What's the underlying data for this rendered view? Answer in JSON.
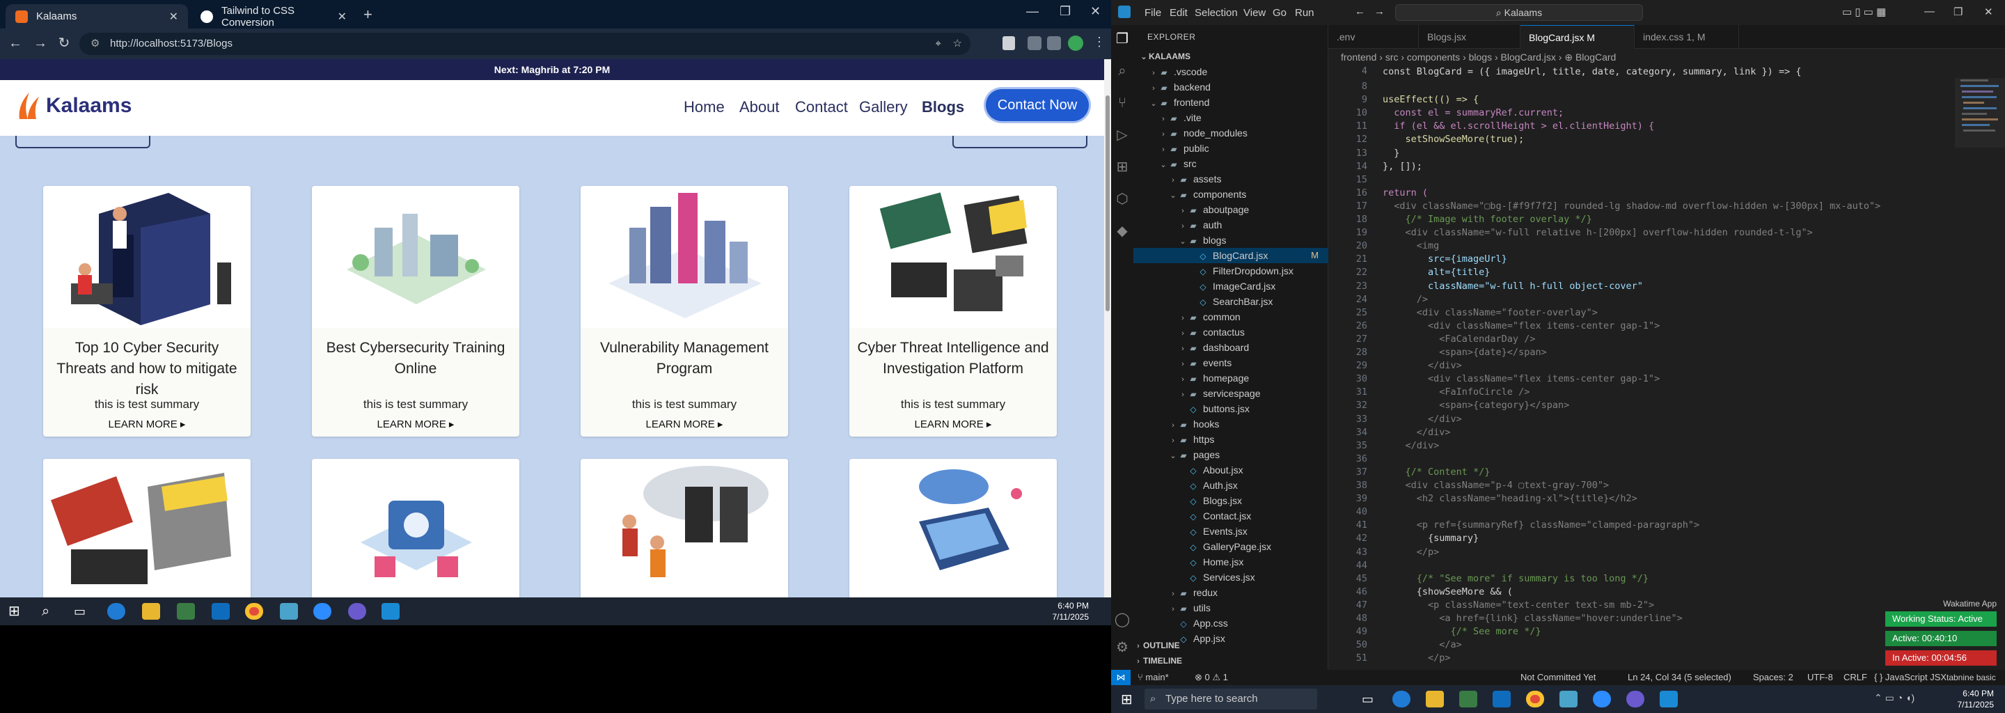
{
  "browser": {
    "tabs": [
      {
        "title": "Kalaams",
        "active": true
      },
      {
        "title": "Tailwind to CSS Conversion",
        "active": false
      }
    ],
    "new_tab": "+",
    "url": "http://localhost:5173/Blogs"
  },
  "site": {
    "prayer_bar": "Next: Maghrib at 7:20 PM",
    "logo_text": "Kalaams",
    "nav": [
      "Home",
      "About",
      "Contact",
      "Gallery",
      "Blogs"
    ],
    "contact_button": "Contact Now",
    "cards": [
      {
        "title": "Top 10 Cyber Security Threats and how to mitigate risk",
        "summary": "this is test summary",
        "learn": "LEARN MORE ▸"
      },
      {
        "title": "Best Cybersecurity Training Online",
        "summary": "this is test summary",
        "learn": "LEARN MORE ▸"
      },
      {
        "title": "Vulnerability Management Program",
        "summary": "this is test summary",
        "learn": "LEARN MORE ▸"
      },
      {
        "title": "Cyber Threat Intelligence and Investigation Platform",
        "summary": "this is test summary",
        "learn": "LEARN MORE ▸"
      },
      {
        "title": "",
        "summary": "",
        "learn": ""
      },
      {
        "title": "",
        "summary": "",
        "learn": ""
      },
      {
        "title": "",
        "summary": "",
        "learn": ""
      },
      {
        "title": "",
        "summary": "",
        "learn": ""
      }
    ]
  },
  "taskbar_left": {
    "time": "6:40 PM",
    "date": "7/11/2025"
  },
  "vscode": {
    "menu": [
      "File",
      "Edit",
      "Selection",
      "View",
      "Go",
      "Run"
    ],
    "command_center": "Kalaams",
    "explorer_title": "EXPLORER",
    "tree": [
      {
        "label": "KALAAMS",
        "depth": 0,
        "type": "root"
      },
      {
        "label": ".vscode",
        "depth": 1,
        "type": "folder"
      },
      {
        "label": "backend",
        "depth": 1,
        "type": "folder"
      },
      {
        "label": "frontend",
        "depth": 1,
        "type": "folder-open"
      },
      {
        "label": ".vite",
        "depth": 2,
        "type": "folder"
      },
      {
        "label": "node_modules",
        "depth": 2,
        "type": "folder"
      },
      {
        "label": "public",
        "depth": 2,
        "type": "folder"
      },
      {
        "label": "src",
        "depth": 2,
        "type": "folder-open"
      },
      {
        "label": "assets",
        "depth": 3,
        "type": "folder"
      },
      {
        "label": "components",
        "depth": 3,
        "type": "folder-open"
      },
      {
        "label": "aboutpage",
        "depth": 4,
        "type": "folder"
      },
      {
        "label": "auth",
        "depth": 4,
        "type": "folder"
      },
      {
        "label": "blogs",
        "depth": 4,
        "type": "folder-open"
      },
      {
        "label": "BlogCard.jsx",
        "depth": 5,
        "type": "file",
        "badge": "M"
      },
      {
        "label": "FilterDropdown.jsx",
        "depth": 5,
        "type": "file"
      },
      {
        "label": "ImageCard.jsx",
        "depth": 5,
        "type": "file"
      },
      {
        "label": "SearchBar.jsx",
        "depth": 5,
        "type": "file"
      },
      {
        "label": "common",
        "depth": 4,
        "type": "folder"
      },
      {
        "label": "contactus",
        "depth": 4,
        "type": "folder"
      },
      {
        "label": "dashboard",
        "depth": 4,
        "type": "folder"
      },
      {
        "label": "events",
        "depth": 4,
        "type": "folder"
      },
      {
        "label": "homepage",
        "depth": 4,
        "type": "folder"
      },
      {
        "label": "servicespage",
        "depth": 4,
        "type": "folder"
      },
      {
        "label": "buttons.jsx",
        "depth": 4,
        "type": "file"
      },
      {
        "label": "hooks",
        "depth": 3,
        "type": "folder"
      },
      {
        "label": "https",
        "depth": 3,
        "type": "folder"
      },
      {
        "label": "pages",
        "depth": 3,
        "type": "folder-open"
      },
      {
        "label": "About.jsx",
        "depth": 4,
        "type": "file"
      },
      {
        "label": "Auth.jsx",
        "depth": 4,
        "type": "file"
      },
      {
        "label": "Blogs.jsx",
        "depth": 4,
        "type": "file"
      },
      {
        "label": "Contact.jsx",
        "depth": 4,
        "type": "file"
      },
      {
        "label": "Events.jsx",
        "depth": 4,
        "type": "file"
      },
      {
        "label": "GalleryPage.jsx",
        "depth": 4,
        "type": "file"
      },
      {
        "label": "Home.jsx",
        "depth": 4,
        "type": "file"
      },
      {
        "label": "Services.jsx",
        "depth": 4,
        "type": "file"
      },
      {
        "label": "redux",
        "depth": 3,
        "type": "folder"
      },
      {
        "label": "utils",
        "depth": 3,
        "type": "folder"
      },
      {
        "label": "App.css",
        "depth": 3,
        "type": "file"
      },
      {
        "label": "App.jsx",
        "depth": 3,
        "type": "file"
      }
    ],
    "outline": "OUTLINE",
    "timeline": "TIMELINE",
    "editor_tabs": [
      ".env",
      "Blogs.jsx",
      "BlogCard.jsx M",
      "index.css 1, M"
    ],
    "breadcrumb": "frontend › src › components › blogs › BlogCard.jsx › ⊕ BlogCard",
    "sticky_line": "const BlogCard = ({ imageUrl, title, date, category, summary, link }) => {",
    "code_lines": [
      {
        "n": "8",
        "t": ""
      },
      {
        "n": "9",
        "t": "useEffect(() => {"
      },
      {
        "n": "10",
        "t": "  const el = summaryRef.current;"
      },
      {
        "n": "11",
        "t": "  if (el && el.scrollHeight > el.clientHeight) {"
      },
      {
        "n": "12",
        "t": "    setShowSeeMore(true);"
      },
      {
        "n": "13",
        "t": "  }"
      },
      {
        "n": "14",
        "t": "}, []);"
      },
      {
        "n": "15",
        "t": ""
      },
      {
        "n": "16",
        "t": "return ("
      },
      {
        "n": "17",
        "t": "  <div className=\"▢bg-[#f9f7f2] rounded-lg shadow-md overflow-hidden w-[300px] mx-auto\">"
      },
      {
        "n": "18",
        "t": "    {/* Image with footer overlay */}"
      },
      {
        "n": "19",
        "t": "    <div className=\"w-full relative h-[200px] overflow-hidden rounded-t-lg\">"
      },
      {
        "n": "20",
        "t": "      <img"
      },
      {
        "n": "21",
        "t": "        src={imageUrl}"
      },
      {
        "n": "22",
        "t": "        alt={title}"
      },
      {
        "n": "23",
        "t": "        className=\"w-full h-full object-cover\""
      },
      {
        "n": "24",
        "t": "      />"
      },
      {
        "n": "25",
        "t": "      <div className=\"footer-overlay\">"
      },
      {
        "n": "26",
        "t": "        <div className=\"flex items-center gap-1\">"
      },
      {
        "n": "27",
        "t": "          <FaCalendarDay />"
      },
      {
        "n": "28",
        "t": "          <span>{date}</span>"
      },
      {
        "n": "29",
        "t": "        </div>"
      },
      {
        "n": "30",
        "t": "        <div className=\"flex items-center gap-1\">"
      },
      {
        "n": "31",
        "t": "          <FaInfoCircle />"
      },
      {
        "n": "32",
        "t": "          <span>{category}</span>"
      },
      {
        "n": "33",
        "t": "        </div>"
      },
      {
        "n": "34",
        "t": "      </div>"
      },
      {
        "n": "35",
        "t": "    </div>"
      },
      {
        "n": "36",
        "t": ""
      },
      {
        "n": "37",
        "t": "    {/* Content */}"
      },
      {
        "n": "38",
        "t": "    <div className=\"p-4 ▢text-gray-700\">"
      },
      {
        "n": "39",
        "t": "      <h2 className=\"heading-xl\">{title}</h2>"
      },
      {
        "n": "40",
        "t": ""
      },
      {
        "n": "41",
        "t": "      <p ref={summaryRef} className=\"clamped-paragraph\">"
      },
      {
        "n": "42",
        "t": "        {summary}"
      },
      {
        "n": "43",
        "t": "      </p>"
      },
      {
        "n": "44",
        "t": ""
      },
      {
        "n": "45",
        "t": "      {/* \"See more\" if summary is too long */}"
      },
      {
        "n": "46",
        "t": "      {showSeeMore && ("
      },
      {
        "n": "47",
        "t": "        <p className=\"text-center text-sm mb-2\">"
      },
      {
        "n": "48",
        "t": "          <a href={link} className=\"hover:underline\">"
      },
      {
        "n": "49",
        "t": "            {/* See more */}"
      },
      {
        "n": "50",
        "t": "          </a>"
      },
      {
        "n": "51",
        "t": "        </p>"
      }
    ],
    "status": {
      "branch": "main*",
      "errors": "⊗ 0 ⚠ 1",
      "commit": "Not Committed Yet",
      "position": "Ln 24, Col 34 (5 selected)",
      "spaces": "Spaces: 2",
      "encoding": "UTF-8",
      "eol": "CRLF",
      "language": "{ } JavaScript JSX",
      "extra": "tabnine basic"
    },
    "tracker": {
      "title": "Wakatime App",
      "working": "Working Status: Active",
      "active": "Active: 00:40:10",
      "inactive": "In Active: 00:04:56"
    }
  },
  "taskbar_right": {
    "search": "Type here to search",
    "time": "6:40 PM",
    "date": "7/11/2025"
  }
}
